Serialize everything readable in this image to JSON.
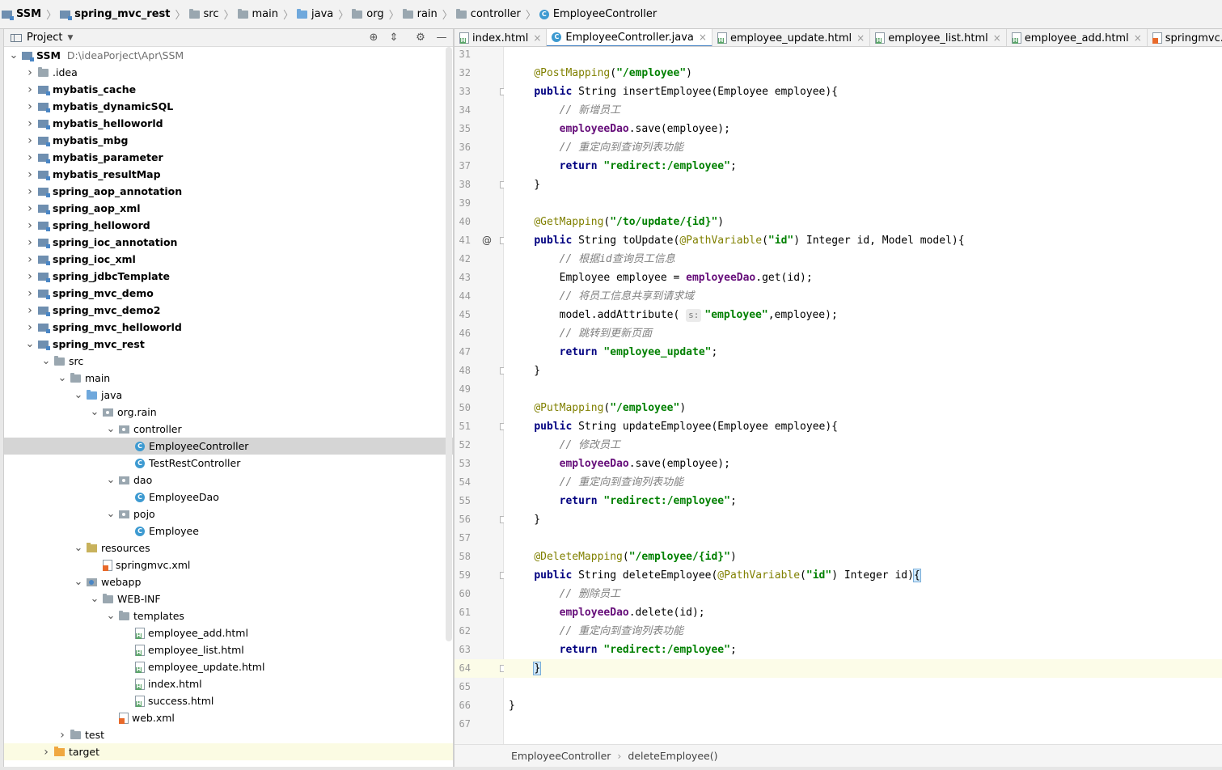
{
  "breadcrumb": [
    {
      "label": "SSM",
      "icon": "module-icon",
      "bold": true
    },
    {
      "label": "spring_mvc_rest",
      "icon": "module-icon",
      "bold": true
    },
    {
      "label": "src",
      "icon": "folder-icon"
    },
    {
      "label": "main",
      "icon": "folder-icon"
    },
    {
      "label": "java",
      "icon": "source-folder-icon"
    },
    {
      "label": "org",
      "icon": "folder-icon"
    },
    {
      "label": "rain",
      "icon": "folder-icon"
    },
    {
      "label": "controller",
      "icon": "folder-icon"
    },
    {
      "label": "EmployeeController",
      "icon": "class-icon"
    }
  ],
  "project_panel": {
    "title": "Project",
    "tools": [
      "locate-icon",
      "collapse-icon",
      "gear-icon",
      "minimize-icon"
    ]
  },
  "tree": [
    {
      "label": "SSM",
      "path": "D:\\ideaPorject\\Apr\\SSM",
      "depth": 0,
      "expanded": true,
      "icon": "module",
      "bold": true
    },
    {
      "label": ".idea",
      "depth": 1,
      "expanded": false,
      "icon": "folder"
    },
    {
      "label": "mybatis_cache",
      "depth": 1,
      "expanded": false,
      "icon": "module",
      "bold": true
    },
    {
      "label": "mybatis_dynamicSQL",
      "depth": 1,
      "expanded": false,
      "icon": "module",
      "bold": true
    },
    {
      "label": "mybatis_helloworld",
      "depth": 1,
      "expanded": false,
      "icon": "module",
      "bold": true
    },
    {
      "label": "mybatis_mbg",
      "depth": 1,
      "expanded": false,
      "icon": "module",
      "bold": true
    },
    {
      "label": "mybatis_parameter",
      "depth": 1,
      "expanded": false,
      "icon": "module",
      "bold": true
    },
    {
      "label": "mybatis_resultMap",
      "depth": 1,
      "expanded": false,
      "icon": "module",
      "bold": true
    },
    {
      "label": "spring_aop_annotation",
      "depth": 1,
      "expanded": false,
      "icon": "module",
      "bold": true
    },
    {
      "label": "spring_aop_xml",
      "depth": 1,
      "expanded": false,
      "icon": "module",
      "bold": true
    },
    {
      "label": "spring_helloword",
      "depth": 1,
      "expanded": false,
      "icon": "module",
      "bold": true
    },
    {
      "label": "spring_ioc_annotation",
      "depth": 1,
      "expanded": false,
      "icon": "module",
      "bold": true
    },
    {
      "label": "spring_ioc_xml",
      "depth": 1,
      "expanded": false,
      "icon": "module",
      "bold": true
    },
    {
      "label": "spring_jdbcTemplate",
      "depth": 1,
      "expanded": false,
      "icon": "module",
      "bold": true
    },
    {
      "label": "spring_mvc_demo",
      "depth": 1,
      "expanded": false,
      "icon": "module",
      "bold": true
    },
    {
      "label": "spring_mvc_demo2",
      "depth": 1,
      "expanded": false,
      "icon": "module",
      "bold": true
    },
    {
      "label": "spring_mvc_helloworld",
      "depth": 1,
      "expanded": false,
      "icon": "module",
      "bold": true
    },
    {
      "label": "spring_mvc_rest",
      "depth": 1,
      "expanded": true,
      "icon": "module",
      "bold": true
    },
    {
      "label": "src",
      "depth": 2,
      "expanded": true,
      "icon": "folder"
    },
    {
      "label": "main",
      "depth": 3,
      "expanded": true,
      "icon": "folder"
    },
    {
      "label": "java",
      "depth": 4,
      "expanded": true,
      "icon": "source"
    },
    {
      "label": "org.rain",
      "depth": 5,
      "expanded": true,
      "icon": "package"
    },
    {
      "label": "controller",
      "depth": 6,
      "expanded": true,
      "icon": "package"
    },
    {
      "label": "EmployeeController",
      "depth": 7,
      "icon": "class",
      "selected": true
    },
    {
      "label": "TestRestController",
      "depth": 7,
      "icon": "class"
    },
    {
      "label": "dao",
      "depth": 6,
      "expanded": true,
      "icon": "package"
    },
    {
      "label": "EmployeeDao",
      "depth": 7,
      "icon": "class"
    },
    {
      "label": "pojo",
      "depth": 6,
      "expanded": true,
      "icon": "package"
    },
    {
      "label": "Employee",
      "depth": 7,
      "icon": "class"
    },
    {
      "label": "resources",
      "depth": 4,
      "expanded": true,
      "icon": "resources"
    },
    {
      "label": "springmvc.xml",
      "depth": 5,
      "icon": "xml"
    },
    {
      "label": "webapp",
      "depth": 4,
      "expanded": true,
      "icon": "web"
    },
    {
      "label": "WEB-INF",
      "depth": 5,
      "expanded": true,
      "icon": "folder"
    },
    {
      "label": "templates",
      "depth": 6,
      "expanded": true,
      "icon": "folder"
    },
    {
      "label": "employee_add.html",
      "depth": 7,
      "icon": "html"
    },
    {
      "label": "employee_list.html",
      "depth": 7,
      "icon": "html"
    },
    {
      "label": "employee_update.html",
      "depth": 7,
      "icon": "html"
    },
    {
      "label": "index.html",
      "depth": 7,
      "icon": "html"
    },
    {
      "label": "success.html",
      "depth": 7,
      "icon": "html"
    },
    {
      "label": "web.xml",
      "depth": 6,
      "icon": "xml"
    },
    {
      "label": "test",
      "depth": 3,
      "expanded": false,
      "icon": "folder"
    },
    {
      "label": "target",
      "depth": 2,
      "expanded": false,
      "icon": "target",
      "hilite": true
    }
  ],
  "tabs": [
    {
      "label": "index.html",
      "icon": "html"
    },
    {
      "label": "EmployeeController.java",
      "icon": "class",
      "active": true
    },
    {
      "label": "employee_update.html",
      "icon": "html"
    },
    {
      "label": "employee_list.html",
      "icon": "html"
    },
    {
      "label": "employee_add.html",
      "icon": "html"
    },
    {
      "label": "springmvc.xml",
      "icon": "xml"
    }
  ],
  "code_lines": [
    {
      "n": "31",
      "tokens": []
    },
    {
      "n": "32",
      "tokens": [
        [
          "",
          "    "
        ],
        [
          "an",
          "@PostMapping"
        ],
        [
          "",
          "("
        ],
        [
          "str",
          "\"/employee\""
        ],
        [
          "",
          ")"
        ]
      ]
    },
    {
      "n": "33",
      "fold": true,
      "tokens": [
        [
          "",
          "    "
        ],
        [
          "kw",
          "public"
        ],
        [
          "",
          " String insertEmployee(Employee employee){"
        ]
      ]
    },
    {
      "n": "34",
      "tokens": [
        [
          "",
          "        "
        ],
        [
          "cm",
          "// 新增员工"
        ]
      ]
    },
    {
      "n": "35",
      "tokens": [
        [
          "",
          "        "
        ],
        [
          "fld",
          "employeeDao"
        ],
        [
          "",
          ".save(employee);"
        ]
      ]
    },
    {
      "n": "36",
      "tokens": [
        [
          "",
          "        "
        ],
        [
          "cm",
          "// 重定向到查询列表功能"
        ]
      ]
    },
    {
      "n": "37",
      "tokens": [
        [
          "",
          "        "
        ],
        [
          "kw",
          "return"
        ],
        [
          "",
          " "
        ],
        [
          "str",
          "\"redirect:/employee\""
        ],
        [
          "",
          ";"
        ]
      ]
    },
    {
      "n": "38",
      "fold": true,
      "tokens": [
        [
          "",
          "    }"
        ]
      ]
    },
    {
      "n": "39",
      "tokens": []
    },
    {
      "n": "40",
      "tokens": [
        [
          "",
          "    "
        ],
        [
          "an",
          "@GetMapping"
        ],
        [
          "",
          "("
        ],
        [
          "str",
          "\"/to/update/{id}\""
        ],
        [
          "",
          ")"
        ]
      ]
    },
    {
      "n": "41",
      "fold": true,
      "at": true,
      "tokens": [
        [
          "",
          "    "
        ],
        [
          "kw",
          "public"
        ],
        [
          "",
          " String toUpdate("
        ],
        [
          "an",
          "@PathVariable"
        ],
        [
          "",
          "("
        ],
        [
          "str",
          "\"id\""
        ],
        [
          "",
          ") Integer id, Model model){"
        ]
      ]
    },
    {
      "n": "42",
      "tokens": [
        [
          "",
          "        "
        ],
        [
          "cm",
          "// 根据id查询员工信息"
        ]
      ]
    },
    {
      "n": "43",
      "tokens": [
        [
          "",
          "        Employee employee = "
        ],
        [
          "fld",
          "employeeDao"
        ],
        [
          "",
          ".get(id);"
        ]
      ]
    },
    {
      "n": "44",
      "tokens": [
        [
          "",
          "        "
        ],
        [
          "cm",
          "// 将员工信息共享到请求域"
        ]
      ]
    },
    {
      "n": "45",
      "tokens": [
        [
          "",
          "        model.addAttribute( "
        ],
        [
          "hint",
          "s:"
        ],
        [
          "str",
          "\"employee\""
        ],
        [
          "",
          ",employee);"
        ]
      ]
    },
    {
      "n": "46",
      "tokens": [
        [
          "",
          "        "
        ],
        [
          "cm",
          "// 跳转到更新页面"
        ]
      ]
    },
    {
      "n": "47",
      "tokens": [
        [
          "",
          "        "
        ],
        [
          "kw",
          "return"
        ],
        [
          "",
          " "
        ],
        [
          "str",
          "\"employee_update\""
        ],
        [
          "",
          ";"
        ]
      ]
    },
    {
      "n": "48",
      "fold": true,
      "tokens": [
        [
          "",
          "    }"
        ]
      ]
    },
    {
      "n": "49",
      "tokens": []
    },
    {
      "n": "50",
      "tokens": [
        [
          "",
          "    "
        ],
        [
          "an",
          "@PutMapping"
        ],
        [
          "",
          "("
        ],
        [
          "str",
          "\"/employee\""
        ],
        [
          "",
          ")"
        ]
      ]
    },
    {
      "n": "51",
      "fold": true,
      "tokens": [
        [
          "",
          "    "
        ],
        [
          "kw",
          "public"
        ],
        [
          "",
          " String updateEmployee(Employee employee){"
        ]
      ]
    },
    {
      "n": "52",
      "tokens": [
        [
          "",
          "        "
        ],
        [
          "cm",
          "// 修改员工"
        ]
      ]
    },
    {
      "n": "53",
      "tokens": [
        [
          "",
          "        "
        ],
        [
          "fld",
          "employeeDao"
        ],
        [
          "",
          ".save(employee);"
        ]
      ]
    },
    {
      "n": "54",
      "tokens": [
        [
          "",
          "        "
        ],
        [
          "cm",
          "// 重定向到查询列表功能"
        ]
      ]
    },
    {
      "n": "55",
      "tokens": [
        [
          "",
          "        "
        ],
        [
          "kw",
          "return"
        ],
        [
          "",
          " "
        ],
        [
          "str",
          "\"redirect:/employee\""
        ],
        [
          "",
          ";"
        ]
      ]
    },
    {
      "n": "56",
      "fold": true,
      "tokens": [
        [
          "",
          "    }"
        ]
      ]
    },
    {
      "n": "57",
      "tokens": []
    },
    {
      "n": "58",
      "tokens": [
        [
          "",
          "    "
        ],
        [
          "an",
          "@DeleteMapping"
        ],
        [
          "",
          "("
        ],
        [
          "str",
          "\"/employee/{id}\""
        ],
        [
          "",
          ")"
        ]
      ]
    },
    {
      "n": "59",
      "fold": true,
      "tokens": [
        [
          "",
          "    "
        ],
        [
          "kw",
          "public"
        ],
        [
          "",
          " String deleteEmployee("
        ],
        [
          "an",
          "@PathVariable"
        ],
        [
          "",
          "("
        ],
        [
          "str",
          "\"id\""
        ],
        [
          "",
          ") Integer id)"
        ],
        [
          "brace",
          "{"
        ]
      ]
    },
    {
      "n": "60",
      "tokens": [
        [
          "",
          "        "
        ],
        [
          "cm",
          "// 删除员工"
        ]
      ]
    },
    {
      "n": "61",
      "tokens": [
        [
          "",
          "        "
        ],
        [
          "fld",
          "employeeDao"
        ],
        [
          "",
          ".delete(id);"
        ]
      ]
    },
    {
      "n": "62",
      "tokens": [
        [
          "",
          "        "
        ],
        [
          "cm",
          "// 重定向到查询列表功能"
        ]
      ]
    },
    {
      "n": "63",
      "tokens": [
        [
          "",
          "        "
        ],
        [
          "kw",
          "return"
        ],
        [
          "",
          " "
        ],
        [
          "str",
          "\"redirect:/employee\""
        ],
        [
          "",
          ";"
        ]
      ]
    },
    {
      "n": "64",
      "fold": true,
      "current": true,
      "tokens": [
        [
          "",
          "    "
        ],
        [
          "brace",
          "}"
        ]
      ]
    },
    {
      "n": "65",
      "tokens": []
    },
    {
      "n": "66",
      "tokens": [
        [
          "",
          "}"
        ]
      ]
    },
    {
      "n": "67",
      "tokens": []
    }
  ],
  "editor_breadcrumb": [
    "EmployeeController",
    "deleteEmployee()"
  ]
}
